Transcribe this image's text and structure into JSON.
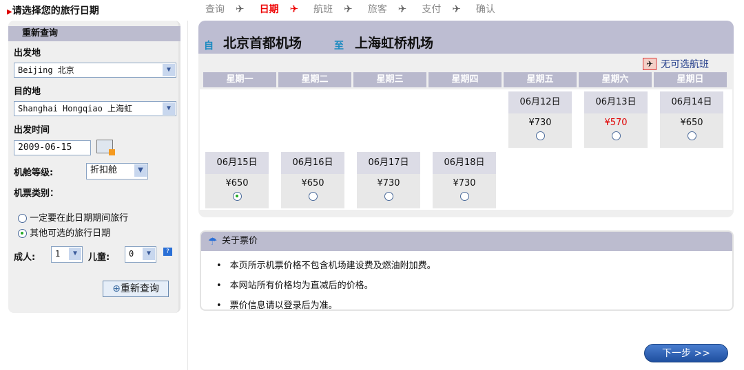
{
  "page_title": "请选择您的旅行日期",
  "steps": [
    "查询",
    "日期",
    "航班",
    "旅客",
    "支付",
    "确认"
  ],
  "active_step": 1,
  "accent": "#e00000",
  "search": {
    "header": "重新查询",
    "origin_label": "出发地",
    "origin_value": "Beijing 北京",
    "dest_label": "目的地",
    "dest_value": "Shanghai Hongqiao 上海虹",
    "date_label": "出发时间",
    "date_value": "2009-06-15",
    "class_label": "机舱等级:",
    "class_value": "折扣舱",
    "type_label": "机票类别：",
    "options": [
      "一定要在此日期期间旅行",
      "其他可选的旅行日期"
    ],
    "selected_option": 1,
    "adult_label": "成人:",
    "adult_value": "1",
    "child_label": "儿童:",
    "child_value": "0",
    "submit": "重新查询"
  },
  "route": {
    "from_prefix": "自",
    "from": "北京首都机场",
    "to_prefix": "至",
    "to": "上海虹桥机场"
  },
  "no_flight_legend": "无可选航班",
  "weekdays": [
    "星期一",
    "星期二",
    "星期三",
    "星期四",
    "星期五",
    "星期六",
    "星期日"
  ],
  "dates": [
    {
      "date": "06月12日",
      "price": "¥730",
      "col": 4,
      "row": 0,
      "low": false,
      "selected": false
    },
    {
      "date": "06月13日",
      "price": "¥570",
      "col": 5,
      "row": 0,
      "low": true,
      "selected": false
    },
    {
      "date": "06月14日",
      "price": "¥650",
      "col": 6,
      "row": 0,
      "low": false,
      "selected": false
    },
    {
      "date": "06月15日",
      "price": "¥650",
      "col": 0,
      "row": 1,
      "low": false,
      "selected": true
    },
    {
      "date": "06月16日",
      "price": "¥650",
      "col": 1,
      "row": 1,
      "low": false,
      "selected": false
    },
    {
      "date": "06月17日",
      "price": "¥730",
      "col": 2,
      "row": 1,
      "low": false,
      "selected": false
    },
    {
      "date": "06月18日",
      "price": "¥730",
      "col": 3,
      "row": 1,
      "low": false,
      "selected": false
    }
  ],
  "price_info": {
    "title": "关于票价",
    "items": [
      "本页所示机票价格不包含机场建设费及燃油附加费。",
      "本网站所有价格均为直减后的价格。",
      "票价信息请以登录后为准。"
    ]
  },
  "next": "下一步 >>"
}
